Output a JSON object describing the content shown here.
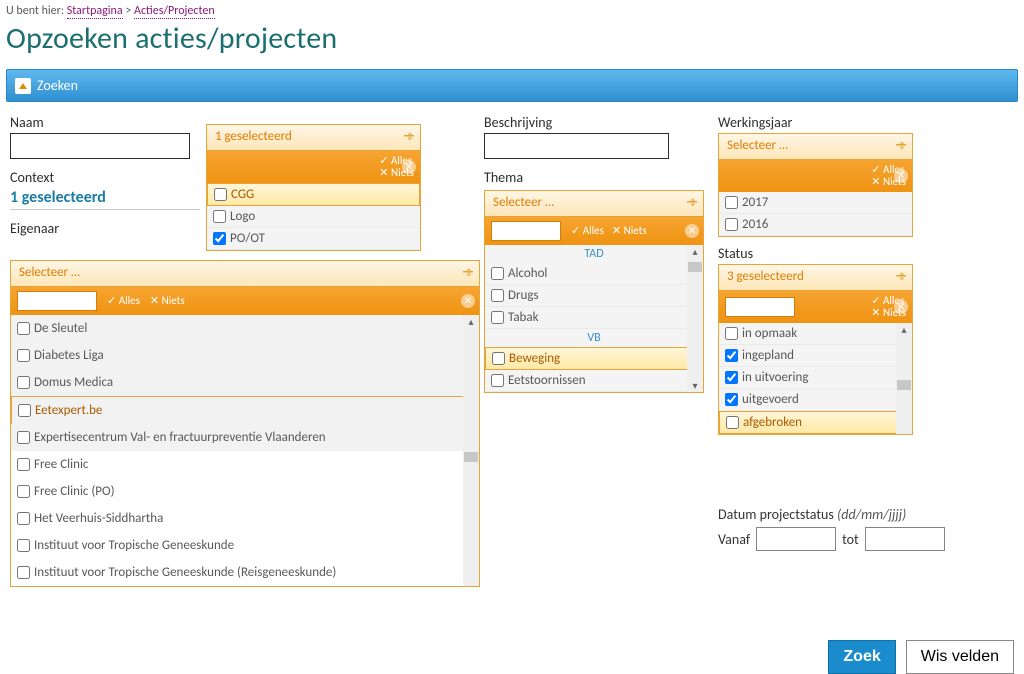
{
  "breadcrumb": {
    "prefix": "U bent hier: ",
    "home": "Startpagina",
    "sep": " > ",
    "current": "Acties/Projecten"
  },
  "page_title": "Opzoeken acties/projecten",
  "searchbar_label": "Zoeken",
  "labels": {
    "naam": "Naam",
    "context": "Context",
    "eigenaar": "Eigenaar",
    "beschrijving": "Beschrijving",
    "thema": "Thema",
    "werkingsjaar": "Werkingsjaar",
    "status": "Status",
    "date_section": "Datum projectstatus ",
    "date_hint": "(dd/mm/jjjj)",
    "vanaf": "Vanaf",
    "tot": "tot"
  },
  "ms_actions": {
    "all": "Alles",
    "none": "Niets"
  },
  "selectors": {
    "placeholder": "Selecteer …",
    "one_selected": "1 geselecteerd",
    "three_selected": "3 geselecteerd"
  },
  "context_value": "1 geselecteerd",
  "naam_ms": {
    "header": "1 geselecteerd",
    "items": [
      {
        "label": "CGG",
        "checked": false,
        "hl": true
      },
      {
        "label": "Logo",
        "checked": false
      },
      {
        "label": "PO/OT",
        "checked": true
      }
    ]
  },
  "eigenaar_ms": {
    "header": "Selecteer …",
    "items": [
      {
        "label": "De Sleutel",
        "checked": false
      },
      {
        "label": "Diabetes Liga",
        "checked": false
      },
      {
        "label": "Domus Medica",
        "checked": false
      },
      {
        "label": "Eetexpert.be",
        "checked": false,
        "hl": true
      },
      {
        "label": "Expertisecentrum Val- en fractuurpreventie Vlaanderen",
        "checked": false
      },
      {
        "label": "Free Clinic",
        "checked": false
      },
      {
        "label": "Free Clinic (PO)",
        "checked": false
      },
      {
        "label": "Het Veerhuis-Siddhartha",
        "checked": false
      },
      {
        "label": "Instituut voor Tropische Geneeskunde",
        "checked": false
      },
      {
        "label": "Instituut voor Tropische Geneeskunde (Reisgeneeskunde)",
        "checked": false
      }
    ]
  },
  "thema_ms": {
    "header": "Selecteer …",
    "groups": [
      {
        "title": "TAD",
        "items": [
          {
            "label": "Alcohol",
            "checked": false
          },
          {
            "label": "Drugs",
            "checked": false
          },
          {
            "label": "Tabak",
            "checked": false
          }
        ]
      },
      {
        "title": "VB",
        "items": [
          {
            "label": "Beweging",
            "checked": false,
            "hl": true
          },
          {
            "label": "Eetstoornissen",
            "checked": false
          }
        ]
      }
    ]
  },
  "werkingsjaar_ms": {
    "header": "Selecteer …",
    "items": [
      {
        "label": "2017",
        "checked": false
      },
      {
        "label": "2016",
        "checked": false
      }
    ]
  },
  "status_ms": {
    "header": "3 geselecteerd",
    "items": [
      {
        "label": "in opmaak",
        "checked": false
      },
      {
        "label": "ingepland",
        "checked": true
      },
      {
        "label": "in uitvoering",
        "checked": true
      },
      {
        "label": "uitgevoerd",
        "checked": true
      },
      {
        "label": "afgebroken",
        "checked": false,
        "hl": true
      }
    ]
  },
  "buttons": {
    "search": "Zoek",
    "clear": "Wis velden"
  }
}
